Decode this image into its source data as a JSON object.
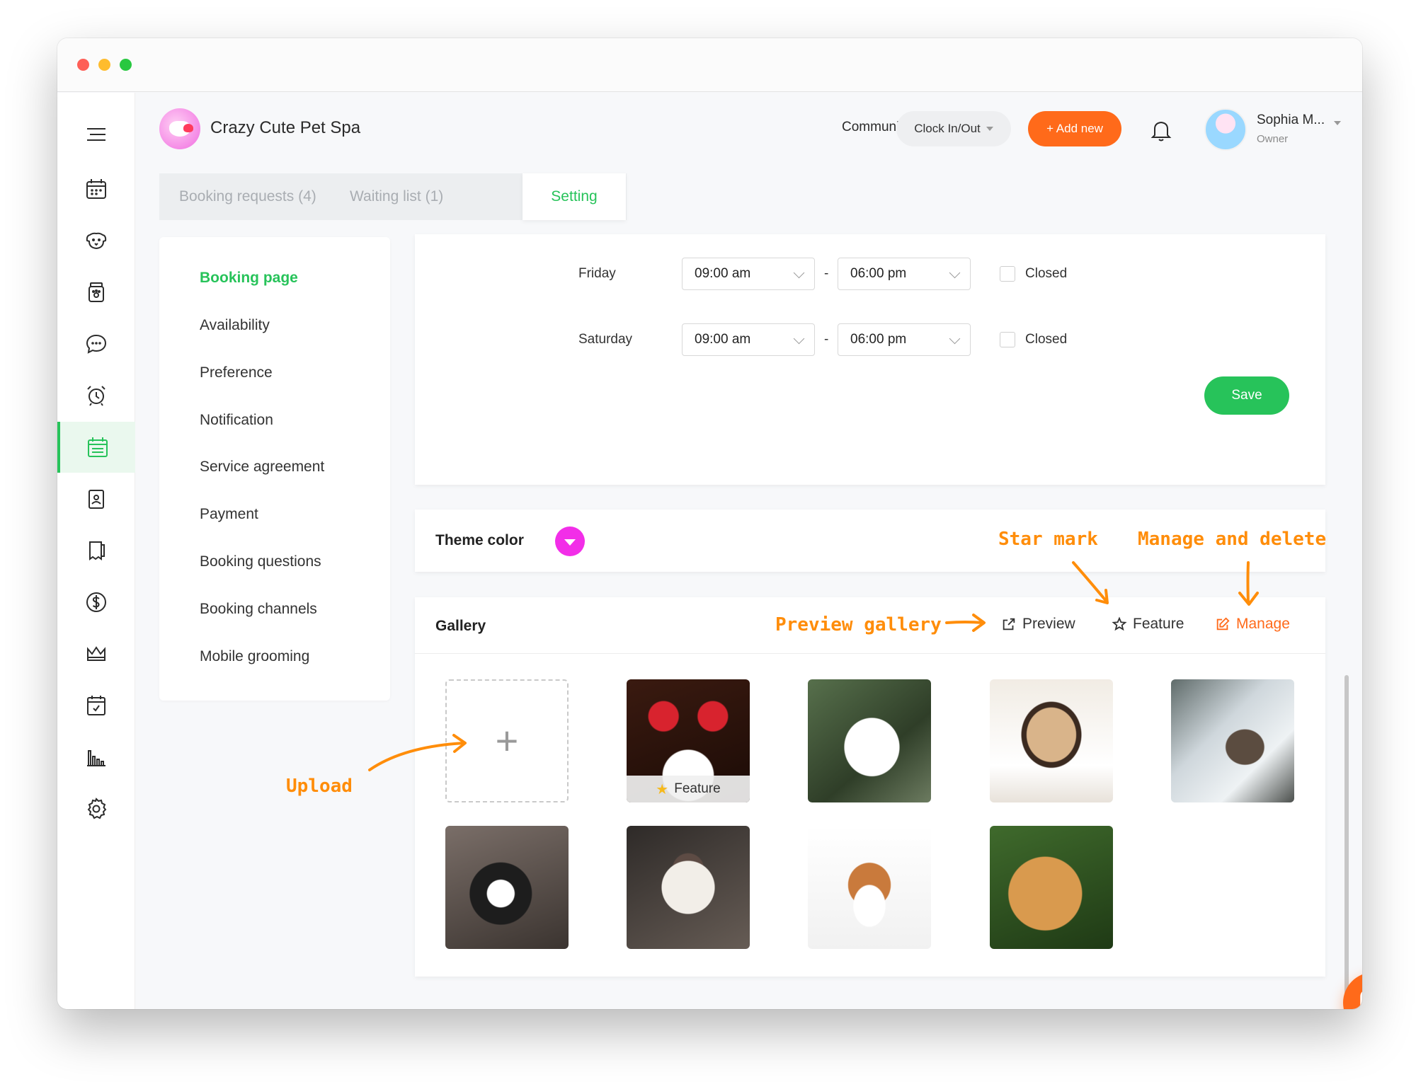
{
  "app": {
    "business_name": "Crazy Cute Pet Spa"
  },
  "header": {
    "community": "Community",
    "clock": "Clock In/Out",
    "add_new": "+ Add new",
    "user_name": "Sophia M...",
    "user_role": "Owner"
  },
  "tabs": [
    {
      "label": "Booking requests (4)"
    },
    {
      "label": "Waiting list (1)"
    },
    {
      "label": "Setting"
    }
  ],
  "menu": [
    {
      "label": "Booking page",
      "active": true
    },
    {
      "label": "Availability"
    },
    {
      "label": "Preference"
    },
    {
      "label": "Notification"
    },
    {
      "label": "Service agreement"
    },
    {
      "label": "Payment"
    },
    {
      "label": "Booking questions"
    },
    {
      "label": "Booking channels"
    },
    {
      "label": "Mobile grooming"
    }
  ],
  "hours": [
    {
      "day": "Friday",
      "open": "09:00 am",
      "close": "06:00 pm",
      "closed_label": "Closed",
      "closed": false
    },
    {
      "day": "Saturday",
      "open": "09:00 am",
      "close": "06:00 pm",
      "closed_label": "Closed",
      "closed": false
    }
  ],
  "hours_separator": "-",
  "save_label": "Save",
  "theme": {
    "label": "Theme color",
    "color": "#f22ee8"
  },
  "gallery": {
    "title": "Gallery",
    "preview": "Preview",
    "feature": "Feature",
    "manage": "Manage",
    "upload_symbol": "+",
    "feature_tag": "Feature",
    "photo_icons": [
      "reindeer-dog-photo",
      "samoyed-photo",
      "pug-photo",
      "hiker-dog-photo",
      "husky-photo",
      "cat-photo",
      "corgi-photo",
      "golden-retriever-photo"
    ]
  },
  "annotations": {
    "star_mark": "Star mark",
    "manage_delete": "Manage and delete",
    "preview_gallery": "Preview gallery",
    "upload": "Upload"
  },
  "colors": {
    "accent_green": "#27c35a",
    "accent_orange": "#ff6a1a",
    "annotation": "#ff8d0a"
  }
}
